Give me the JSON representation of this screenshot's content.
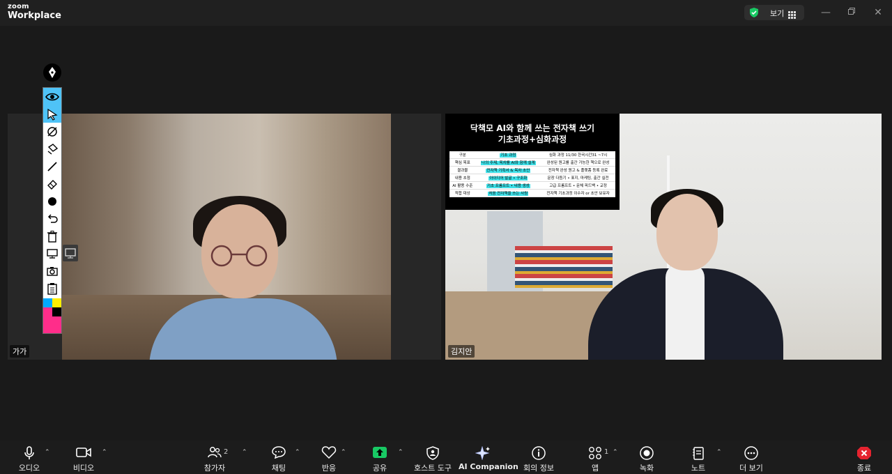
{
  "app": {
    "brand_small": "zoom",
    "brand_large": "Workplace"
  },
  "titlebar": {
    "view_label": "보기"
  },
  "participants": [
    {
      "name": "가가"
    },
    {
      "name": "김지안"
    }
  ],
  "banner": {
    "title_line1": "닥책모 AI와 함께 쓰는 전자책 쓰기",
    "title_line2": "기초과정+심화과정",
    "rows": [
      [
        "구분",
        "기초 과정",
        "심화 과정 11/30 한국시간31 ~7시"
      ],
      [
        "핵심 목표",
        "나의 주제, 목차를 AI와 함께 설계",
        "완성된 원고를 출간 가능한 책으로 완성"
      ],
      [
        "결과물",
        "전자책 기획서 & 목차 초안",
        "전자책 완성 원고 & 플랫폼 등록 완료"
      ],
      [
        "내용 초점",
        "아이디어 발굴 • 구조화",
        "문장 다듬기 • 표지, 마케팅, 출간 실전"
      ],
      [
        "AI 활용 수준",
        "기초 프롬프트 • 내용 생성",
        "고급 프롬프트 • 문체 피드백 • 교정"
      ],
      [
        "적합 대상",
        "처음 전자책을 쓰는 사람",
        "전자책 기초과정 이수자 or 초안 보유자"
      ]
    ]
  },
  "toolbar": {
    "audio": "오디오",
    "video": "비디오",
    "participants": "참가자",
    "participants_count": "2",
    "chat": "채팅",
    "reactions": "반응",
    "share": "공유",
    "host_tools": "호스트 도구",
    "ai_companion": "AI Companion",
    "meeting_info": "회의 정보",
    "apps": "앱",
    "apps_count": "1",
    "record": "녹화",
    "notes": "노트",
    "more": "더 보기",
    "end": "종료"
  },
  "colors": {
    "share_green": "#18c964",
    "end_red": "#e5232f",
    "annotate_active": "#4fc3f7",
    "banner_highlight": "#3ee0e8"
  },
  "annotation_tools": [
    "pen-icon",
    "spotlight-icon",
    "select-icon",
    "hide-icon",
    "stamp-icon",
    "draw-line-icon",
    "eraser-icon",
    "format-dot-icon",
    "undo-icon",
    "delete-icon",
    "monitor-icon",
    "camera-icon",
    "clipboard-icon"
  ]
}
